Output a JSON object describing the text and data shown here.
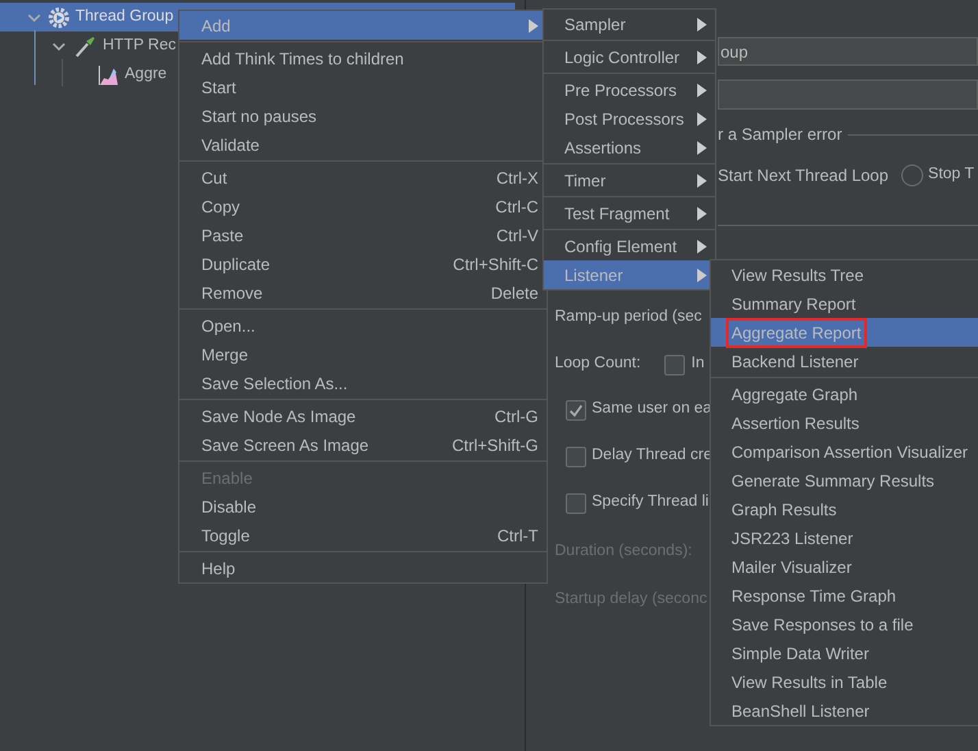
{
  "tree": [
    {
      "label": "Thread Group",
      "kind": "thread-group",
      "selected": true,
      "expanded": true,
      "children": [
        {
          "label": "HTTP Rec",
          "kind": "sampler",
          "selected": false,
          "expanded": true,
          "children": [
            {
              "label": "Aggre",
              "kind": "listener",
              "selected": false
            }
          ]
        }
      ]
    }
  ],
  "panel": {
    "name_value": "oup",
    "error_group_label": "r a Sampler error",
    "continue_label": "Start Next Thread Loop",
    "stop_option": {
      "label": "Stop T",
      "selected": false
    },
    "ramp_up_label": "Ramp-up period (sec",
    "loop_count_label": "Loop Count:",
    "infinite": {
      "label": "In",
      "checked": false
    },
    "checkboxes": [
      {
        "label": "Same user on ea",
        "checked": true
      },
      {
        "label": "Delay Thread cre",
        "checked": false
      },
      {
        "label": "Specify Thread li",
        "checked": false
      }
    ],
    "duration_label": {
      "label": "Duration (seconds):",
      "disabled": true
    },
    "startup_delay_label": {
      "label": "Startup delay (seconc",
      "disabled": true
    }
  },
  "context_menu": {
    "groups": [
      {
        "items": [
          {
            "label": "Add",
            "has_submenu": true,
            "selected": true,
            "disabled": false
          }
        ]
      },
      {
        "items": [
          {
            "label": "Add Think Times to children",
            "selected": false,
            "disabled": false
          },
          {
            "label": "Start",
            "selected": false,
            "disabled": false
          },
          {
            "label": "Start no pauses",
            "selected": false,
            "disabled": false
          },
          {
            "label": "Validate",
            "selected": false,
            "disabled": false
          }
        ]
      },
      {
        "items": [
          {
            "label": "Cut",
            "shortcut": "Ctrl-X",
            "selected": false,
            "disabled": false
          },
          {
            "label": "Copy",
            "shortcut": "Ctrl-C",
            "selected": false,
            "disabled": false
          },
          {
            "label": "Paste",
            "shortcut": "Ctrl-V",
            "selected": false,
            "disabled": false
          },
          {
            "label": "Duplicate",
            "shortcut": "Ctrl+Shift-C",
            "selected": false,
            "disabled": false
          },
          {
            "label": "Remove",
            "shortcut": "Delete",
            "selected": false,
            "disabled": false
          }
        ]
      },
      {
        "items": [
          {
            "label": "Open...",
            "selected": false,
            "disabled": false
          },
          {
            "label": "Merge",
            "selected": false,
            "disabled": false
          },
          {
            "label": "Save Selection As...",
            "selected": false,
            "disabled": false
          }
        ]
      },
      {
        "items": [
          {
            "label": "Save Node As Image",
            "shortcut": "Ctrl-G",
            "selected": false,
            "disabled": false
          },
          {
            "label": "Save Screen As Image",
            "shortcut": "Ctrl+Shift-G",
            "selected": false,
            "disabled": false
          }
        ]
      },
      {
        "items": [
          {
            "label": "Enable",
            "selected": false,
            "disabled": true
          },
          {
            "label": "Disable",
            "selected": false,
            "disabled": false
          },
          {
            "label": "Toggle",
            "shortcut": "Ctrl-T",
            "selected": false,
            "disabled": false
          }
        ]
      },
      {
        "items": [
          {
            "label": "Help",
            "selected": false,
            "disabled": false
          }
        ]
      }
    ]
  },
  "add_submenu": {
    "groups": [
      {
        "items": [
          {
            "label": "Sampler",
            "has_submenu": true,
            "selected": false
          }
        ]
      },
      {
        "items": [
          {
            "label": "Logic Controller",
            "has_submenu": true,
            "selected": false
          }
        ]
      },
      {
        "items": [
          {
            "label": "Pre Processors",
            "has_submenu": true,
            "selected": false
          },
          {
            "label": "Post Processors",
            "has_submenu": true,
            "selected": false
          },
          {
            "label": "Assertions",
            "has_submenu": true,
            "selected": false
          }
        ]
      },
      {
        "items": [
          {
            "label": "Timer",
            "has_submenu": true,
            "selected": false
          }
        ]
      },
      {
        "items": [
          {
            "label": "Test Fragment",
            "has_submenu": true,
            "selected": false
          }
        ]
      },
      {
        "items": [
          {
            "label": "Config Element",
            "has_submenu": true,
            "selected": false
          },
          {
            "label": "Listener",
            "has_submenu": true,
            "selected": true
          }
        ]
      }
    ]
  },
  "listener_submenu": {
    "groups": [
      {
        "items": [
          {
            "label": "View Results Tree",
            "selected": false,
            "marked": false
          },
          {
            "label": "Summary Report",
            "selected": false,
            "marked": false
          },
          {
            "label": "Aggregate Report",
            "selected": true,
            "marked": true
          },
          {
            "label": "Backend Listener",
            "selected": false,
            "marked": false
          }
        ]
      },
      {
        "items": [
          {
            "label": "Aggregate Graph",
            "selected": false,
            "marked": false
          },
          {
            "label": "Assertion Results",
            "selected": false,
            "marked": false
          },
          {
            "label": "Comparison Assertion Visualizer",
            "selected": false,
            "marked": false
          },
          {
            "label": "Generate Summary Results",
            "selected": false,
            "marked": false
          },
          {
            "label": "Graph Results",
            "selected": false,
            "marked": false
          },
          {
            "label": "JSR223 Listener",
            "selected": false,
            "marked": false
          },
          {
            "label": "Mailer Visualizer",
            "selected": false,
            "marked": false
          },
          {
            "label": "Response Time Graph",
            "selected": false,
            "marked": false
          },
          {
            "label": "Save Responses to a file",
            "selected": false,
            "marked": false
          },
          {
            "label": "Simple Data Writer",
            "selected": false,
            "marked": false
          },
          {
            "label": "View Results in Table",
            "selected": false,
            "marked": false
          },
          {
            "label": "BeanShell Listener",
            "selected": false,
            "marked": false
          }
        ]
      }
    ]
  }
}
